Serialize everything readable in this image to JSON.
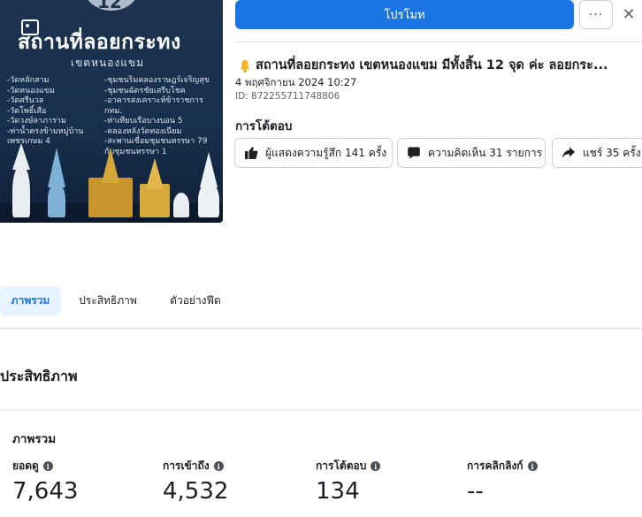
{
  "image": {
    "number": "12",
    "title": "สถานที่ลอยกระทง",
    "subtitle": "เขตหนองแขม",
    "left_list": [
      "-วัดหลักสาม",
      "-วัดหนองแขม",
      "-วัดศรีนวล",
      "-วัดโพธิ์เสือ",
      "-วัดวงษ์ลาภาราม",
      "-ท่าน้ำตรงข้ามหมู่บ้าน",
      "เพชรเกษม 4"
    ],
    "right_list": [
      "-ชุมชนริมคลองราษฎร์เจริญสุข",
      "-ชุมชนฉัตรชัยเสรีบโชค",
      "-อาคารสงเคราะห์ข้าราชการ",
      "กทม.",
      "-ท่าเทียบเรือบางบอน 5",
      "-คลองหลังวัดทองเนียม",
      "-สะพานเชื่อมชุมชนหรรษา 79",
      "กับชุมชนหรรษา 1"
    ]
  },
  "header": {
    "boost_label": "โปรโมท",
    "more_label": "···",
    "close_label": "✕"
  },
  "post": {
    "title": "สถานที่ลอยกระทง เขตหนองแขม มีทั้งสิ้น 12 จุด ค่ะ ลอยกระ...",
    "date": "4 พฤศจิกายน 2024 10:27",
    "id": "ID: 872255711748806"
  },
  "reactions": {
    "heading": "การโต้ตอบ",
    "like_label": "ผู้แสดงความรู้สึก 141 ครั้ง",
    "comment_label": "ความคิดเห็น 31 รายการ",
    "share_label": "แชร์ 35 ครั้ง"
  },
  "tabs": [
    {
      "label": "ภาพรวม",
      "active": true
    },
    {
      "label": "ประสิทธิภาพ",
      "active": false
    },
    {
      "label": "ตัวอย่างฟีด",
      "active": false
    }
  ],
  "performance": {
    "heading": "ประสิทธิภาพ",
    "panel_heading": "ภาพรวม",
    "metrics": [
      {
        "label": "ยอดดู",
        "value": "7,643"
      },
      {
        "label": "การเข้าถึง",
        "value": "4,532"
      },
      {
        "label": "การโต้ตอบ",
        "value": "134"
      },
      {
        "label": "การคลิกลิงก์",
        "value": "--"
      }
    ]
  },
  "colors": {
    "primary": "#1b74e4",
    "tab_active_bg": "#e7f3ff",
    "image_bg": "#1d3350"
  }
}
